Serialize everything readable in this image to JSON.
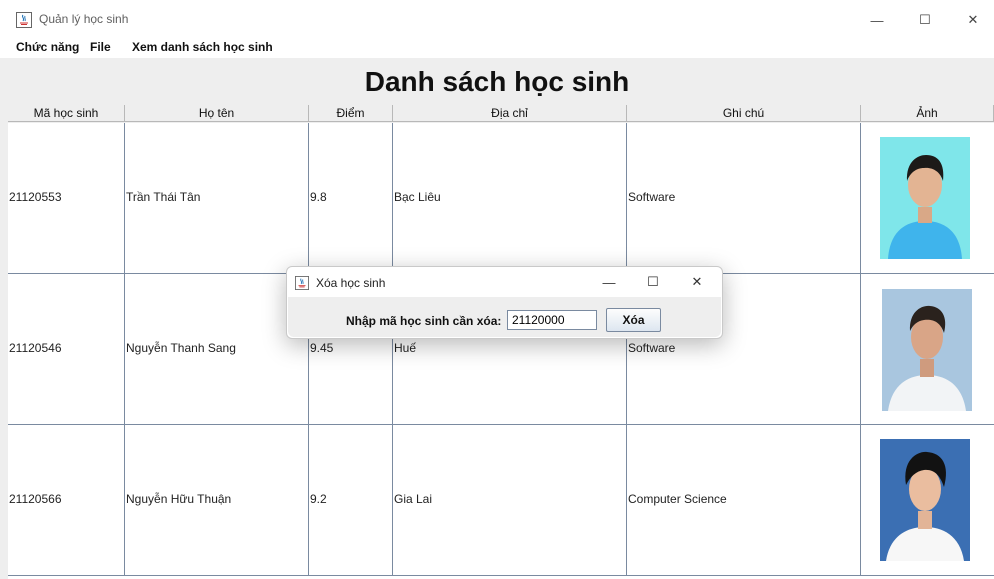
{
  "window": {
    "title": "Quản lý học sinh",
    "minimize": "—",
    "maximize": "☐",
    "close": "✕"
  },
  "menu": [
    "Chức năng",
    "File",
    "Xem danh sách học sinh"
  ],
  "heading": "Danh sách học sinh",
  "table": {
    "columns": [
      "Mã học sinh",
      "Họ tên",
      "Điểm",
      "Địa chỉ",
      "Ghi chú",
      "Ảnh"
    ],
    "rows": [
      {
        "id": "21120553",
        "name": "Trần Thái Tân",
        "score": "9.8",
        "address": "Bạc Liêu",
        "note": "Software"
      },
      {
        "id": "21120546",
        "name": "Nguyễn Thanh Sang",
        "score": "9.45",
        "address": "Huế",
        "note": "Software"
      },
      {
        "id": "21120566",
        "name": "Nguyễn Hữu Thuận",
        "score": "9.2",
        "address": "Gia Lai",
        "note": "Computer Science"
      }
    ]
  },
  "dialog": {
    "title": "Xóa học sinh",
    "label": "Nhập mã học sinh cần xóa:",
    "input_value": "21120000",
    "button": "Xóa",
    "minimize": "—",
    "maximize": "☐",
    "close": "✕"
  },
  "colors": {
    "grid": "#7a8aa0",
    "photo_bg_1": "#7fe6ea",
    "photo_bg_2": "#a9c6df",
    "photo_bg_3": "#3b6fb3"
  }
}
